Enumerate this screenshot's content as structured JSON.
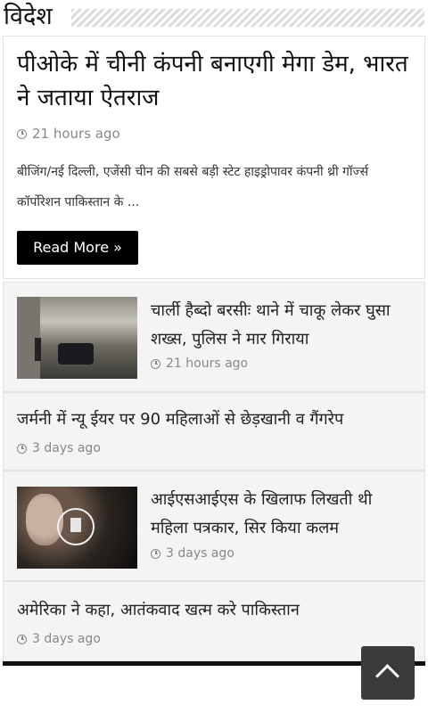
{
  "section": {
    "title": "विदेश"
  },
  "featured": {
    "title": "पीओके में चीनी कंपनी बनाएगी मेगा डेम, भारत ने जताया ऐतराज",
    "time": "21 hours ago",
    "excerpt": "बीजिंग/नई दिल्ली, एजेंसी चीन की सबसे बड़ी स्टेट हाइड्रोपावर कंपनी थ्री गॉर्ज्स कॉर्पोरेशन पाकिस्तान के ...",
    "read_more": "Read More »"
  },
  "items": [
    {
      "title": "चार्ली हैब्दो बरसीः थाने में चाकू लेकर घुसा शख्स, पुलिस ने मार गिराया",
      "time": "21 hours ago"
    },
    {
      "title": "जर्मनी में न्यू ईयर पर 90 महिलाओं से छेड़खानी व गैंगरेप",
      "time": "3 days ago"
    },
    {
      "title": "आईएसआईएस के खिलाफ लिखती थी महिला पत्रकार, सिर किया कलम",
      "time": "3 days ago"
    },
    {
      "title": "अमेरिका ने कहा, आतंकवाद खत्म करे पाकिस्तान",
      "time": "3 days ago"
    }
  ],
  "icons": {
    "clock": "clock-icon",
    "scroll_top": "chevron-up-icon",
    "post_format": "document-icon"
  }
}
